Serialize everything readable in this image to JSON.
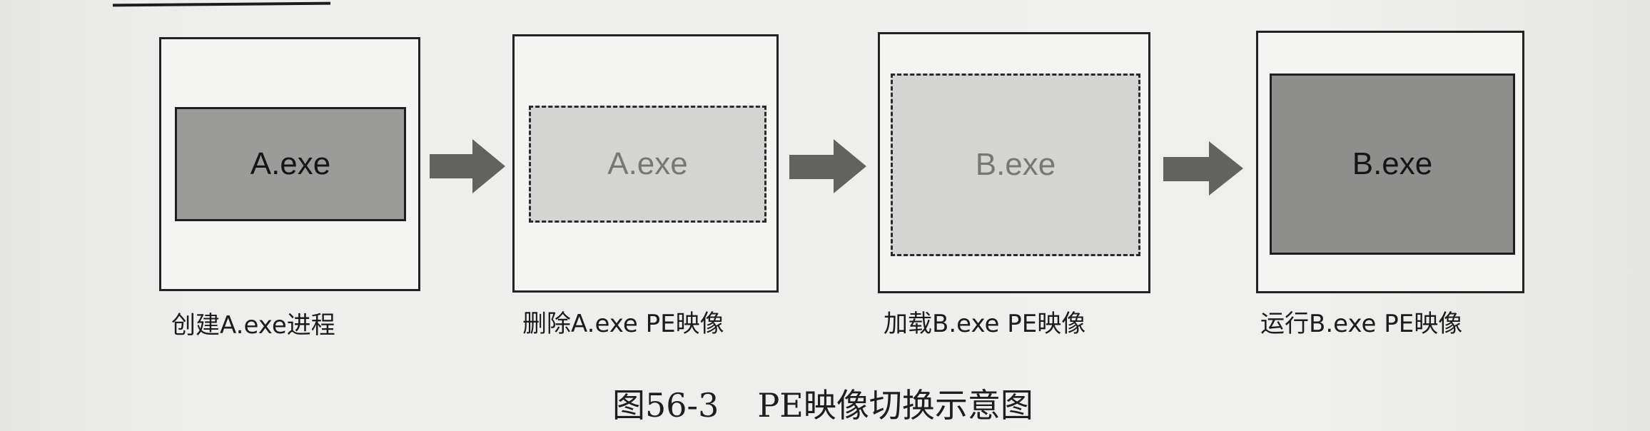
{
  "steps": [
    {
      "inner_label": "A.exe",
      "caption": "创建A.exe进程",
      "style": "solid"
    },
    {
      "inner_label": "A.exe",
      "caption": "删除A.exe PE映像",
      "style": "dashed"
    },
    {
      "inner_label": "B.exe",
      "caption": "加载B.exe PE映像",
      "style": "dashed"
    },
    {
      "inner_label": "B.exe",
      "caption": "运行B.exe PE映像",
      "style": "solid"
    }
  ],
  "figure": {
    "number": "图56-3",
    "title": "PE映像切换示意图"
  },
  "colors": {
    "frame_border": "#222222",
    "loaded_image_fill": "#9b9b99",
    "unloaded_image_fill": "#d4d4d2",
    "arrow_fill": "#626260"
  }
}
